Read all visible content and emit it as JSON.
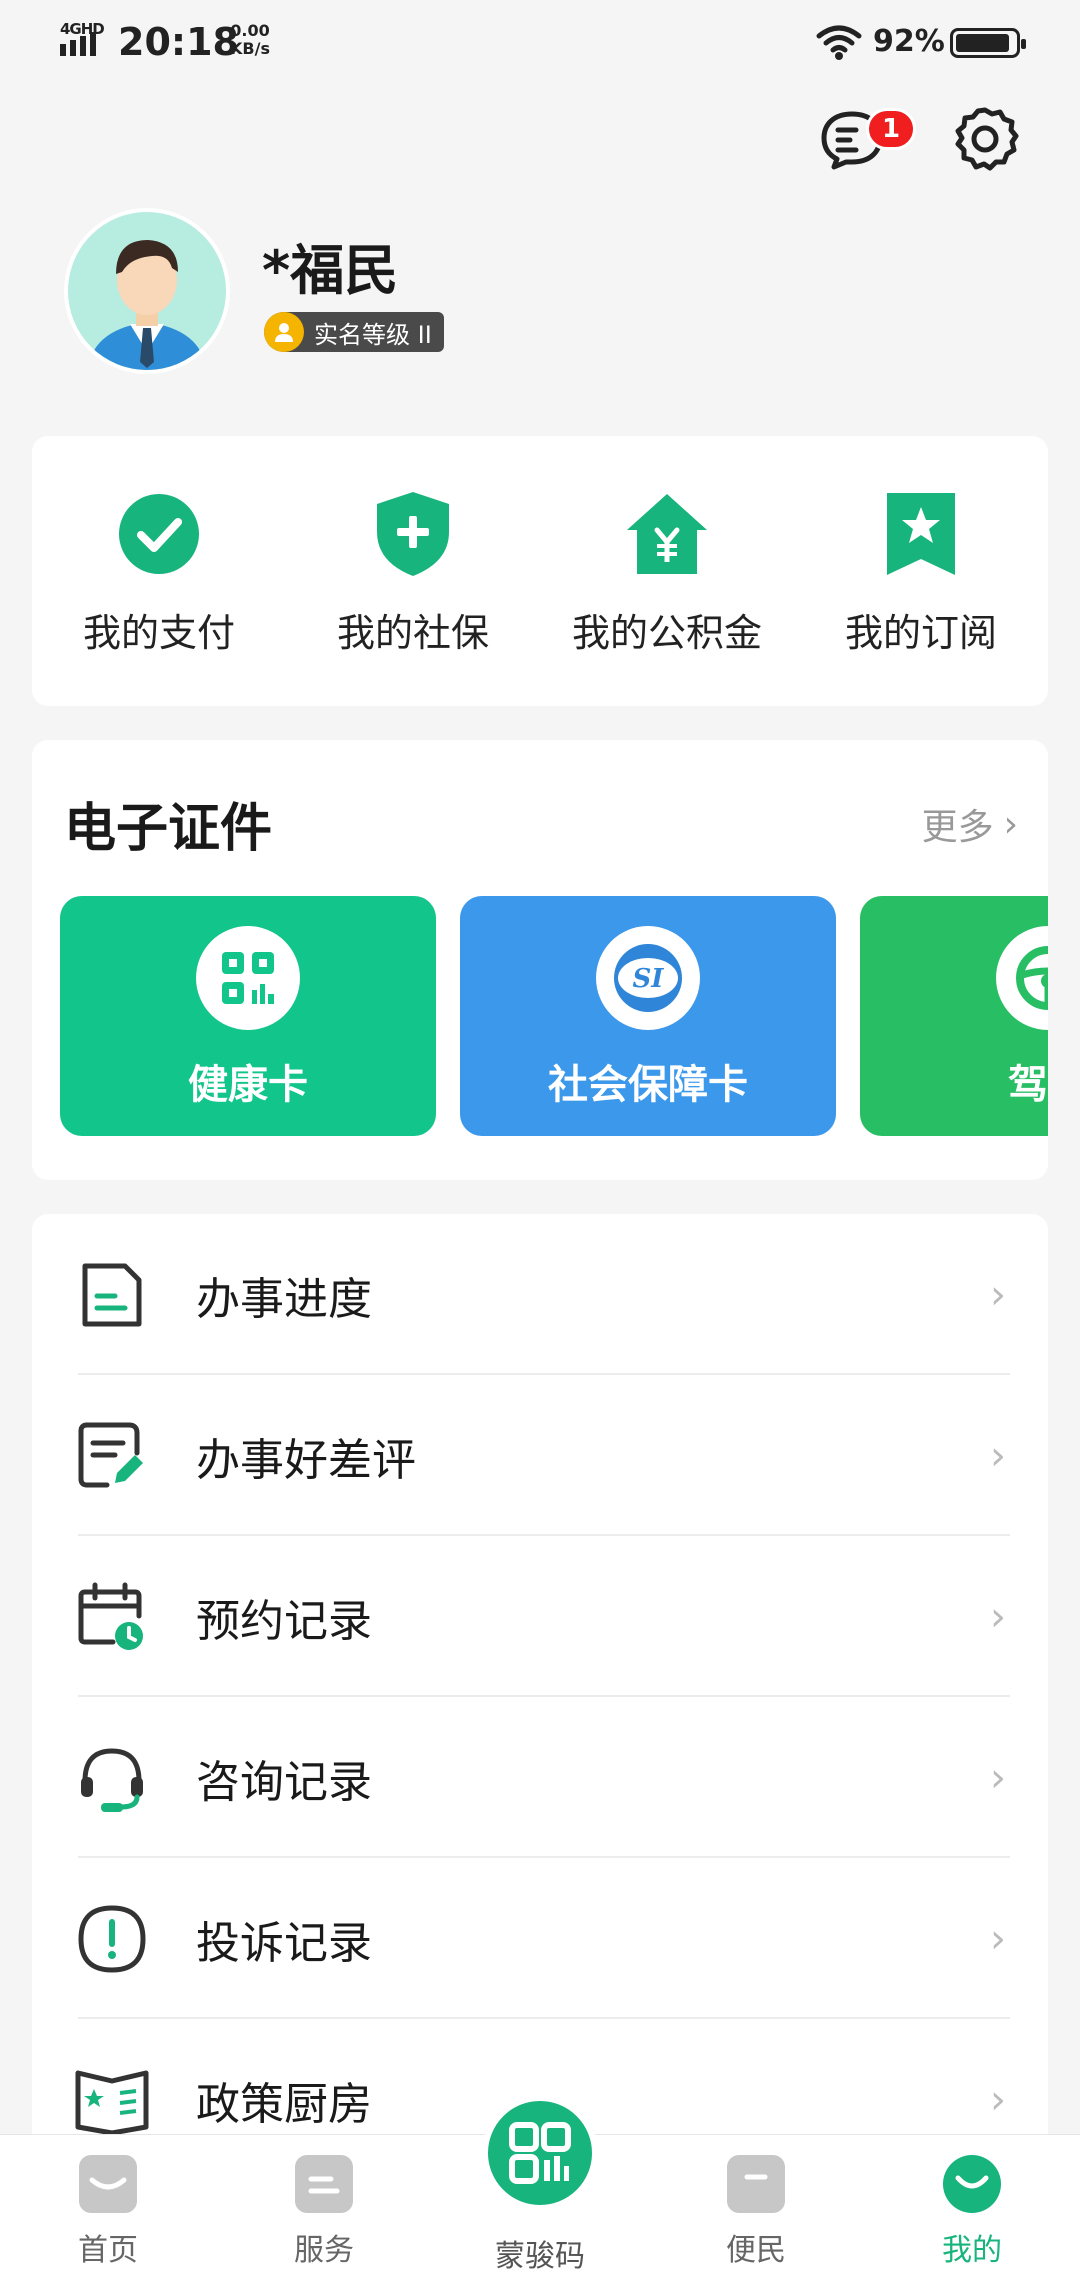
{
  "status_bar": {
    "network": "4GHD",
    "time": "20:18",
    "speed_value": "0.00",
    "speed_unit": "KB/s",
    "battery": "92%",
    "battery_level": 0.92
  },
  "header": {
    "message_badge_count": "1"
  },
  "profile": {
    "name": "*福民",
    "realname_level": "实名等级 II"
  },
  "quick_actions": [
    {
      "label": "我的支付",
      "icon": "check-circle-icon"
    },
    {
      "label": "我的社保",
      "icon": "shield-plus-icon"
    },
    {
      "label": "我的公积金",
      "icon": "house-yuan-icon"
    },
    {
      "label": "我的订阅",
      "icon": "bookmark-star-icon"
    }
  ],
  "certificates": {
    "title": "电子证件",
    "more_label": "更多",
    "items": [
      {
        "label": "健康卡",
        "color": "#12c58a",
        "icon": "qr-code-icon"
      },
      {
        "label": "社会保障卡",
        "color": "#3b98ea",
        "icon": "social-security-icon"
      },
      {
        "label": "驾驶",
        "color": "#27be64",
        "icon": "steering-wheel-icon"
      }
    ]
  },
  "menu": [
    {
      "label": "办事进度",
      "icon": "document-progress-icon"
    },
    {
      "label": "办事好差评",
      "icon": "review-edit-icon"
    },
    {
      "label": "预约记录",
      "icon": "calendar-clock-icon"
    },
    {
      "label": "咨询记录",
      "icon": "headset-icon"
    },
    {
      "label": "投诉记录",
      "icon": "complaint-alert-icon"
    },
    {
      "label": "政策厨房",
      "icon": "policy-book-icon"
    }
  ],
  "bottom_nav": {
    "home": "首页",
    "services": "服务",
    "code": "蒙骏码",
    "convenience": "便民",
    "mine": "我的"
  },
  "colors": {
    "accent": "#18b47d",
    "badge": "#f01e1e"
  }
}
